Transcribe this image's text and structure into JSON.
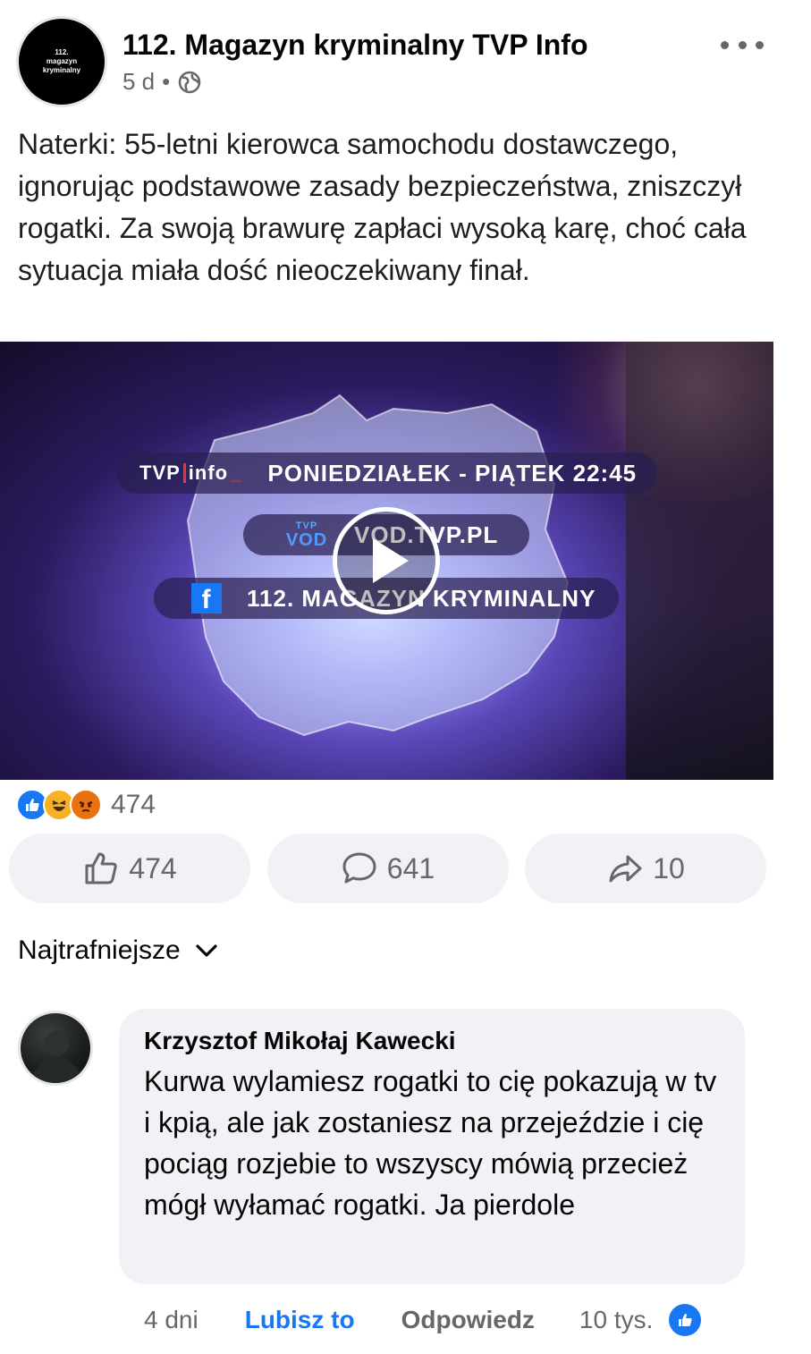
{
  "post": {
    "page_logo_lines": [
      "112.",
      "magazyn",
      "kryminalny"
    ],
    "page_name": "112. Magazyn kryminalny TVP Info",
    "time": "5 d",
    "separator": "•",
    "privacy_icon": "globe-icon",
    "more_icon": "more-dots-icon",
    "text": "Naterki: 55-letni kierowca samochodu dostawczego, ignorując podstawowe zasady bezpieczeństwa, zniszczył rogatki. Za swoją brawurę zapłaci wysoką karę, choć cała sytuacja miała dość nieoczekiwany finał."
  },
  "video": {
    "logo_tvp": "TVP",
    "logo_info": "info",
    "schedule": "PONIEDZIAŁEK - PIĄTEK 22:45",
    "vod_small": "TVP",
    "vod_big": "VOD",
    "vod_url": "VOD.TVP.PL",
    "fb_letter": "f",
    "fb_page": "112. MAGAZYN KRYMINALNY",
    "play_icon": "play-icon"
  },
  "reactions": {
    "types": [
      "like",
      "haha",
      "angry"
    ],
    "total": "474"
  },
  "actions": {
    "like_count": "474",
    "comment_count": "641",
    "share_count": "10"
  },
  "comments": {
    "sort_label": "Najtrafniejsze",
    "items": [
      {
        "author": "Krzysztof Mikołaj Kawecki",
        "text": "Kurwa wylamiesz rogatki to cię pokazują w tv i kpią, ale jak zostaniesz na przejeździe i cię pociąg rozjebie to wszyscy mówią przecież mógł wyłamać rogatki. Ja pierdole",
        "time": "4 dni",
        "like_label": "Lubisz to",
        "reply_label": "Odpowiedz",
        "reaction_count": "10 tys."
      }
    ]
  },
  "colors": {
    "accent": "#1877f2",
    "secondary_text": "#65676b",
    "bubble": "#f0f2f5"
  }
}
